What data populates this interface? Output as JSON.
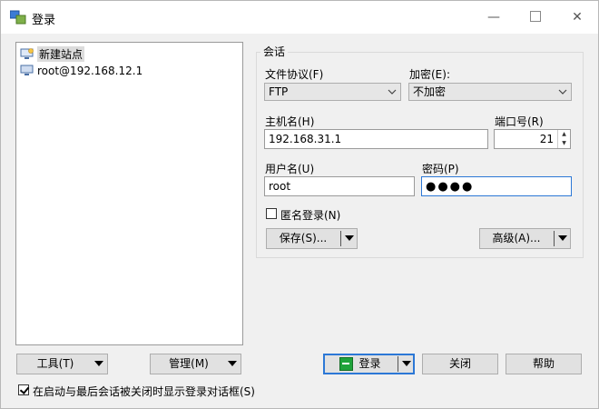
{
  "window": {
    "title": "登录"
  },
  "titlebar": {
    "minimize": "—",
    "maximize": "",
    "close": "✕"
  },
  "tree": {
    "items": [
      {
        "label": "新建站点",
        "selected": true
      },
      {
        "label": "root@192.168.12.1",
        "selected": false
      }
    ]
  },
  "session": {
    "group_title": "会话",
    "protocol_label": "文件协议(F)",
    "protocol_value": "FTP",
    "encryption_label": "加密(E):",
    "encryption_value": "不加密",
    "host_label": "主机名(H)",
    "host_value": "192.168.31.1",
    "port_label": "端口号(R)",
    "port_value": "21",
    "user_label": "用户名(U)",
    "user_value": "root",
    "password_label": "密码(P)",
    "password_masked": "●●●●",
    "anonymous_label": "匿名登录(N)",
    "save_label": "保存(S)...",
    "advanced_label": "高级(A)..."
  },
  "bottom": {
    "tools_label": "工具(T)",
    "manage_label": "管理(M)",
    "login_label": "登录",
    "close_label": "关闭",
    "help_label": "帮助",
    "show_dialog_label": "在启动与最后会话被关闭时显示登录对话框(S)",
    "show_dialog_checked": true
  }
}
